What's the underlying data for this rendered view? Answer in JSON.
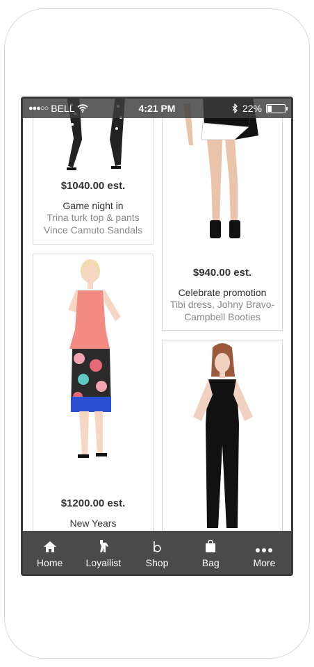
{
  "status_bar": {
    "carrier": "BELL",
    "time": "4:21 PM",
    "battery": "22%"
  },
  "cards": [
    {
      "price": "$1040.00 est.",
      "title": "Game night in",
      "lines": [
        "Trina turk top & pants",
        "Vince Camuto Sandals"
      ]
    },
    {
      "price": "$940.00 est.",
      "title": "Celebrate promotion",
      "lines": [
        "Tibi dress, Johny Bravo-",
        "Campbell Booties"
      ]
    },
    {
      "price": "$1200.00 est.",
      "title": "New Years",
      "lines": []
    },
    {
      "price": "",
      "title": "",
      "lines": []
    }
  ],
  "tab_bar": {
    "items": [
      {
        "label": "Home",
        "icon": "home-icon"
      },
      {
        "label": "Loyallist",
        "icon": "loyallist-icon"
      },
      {
        "label": "Shop",
        "icon": "shop-icon"
      },
      {
        "label": "Bag",
        "icon": "bag-icon"
      },
      {
        "label": "More",
        "icon": "more-icon"
      }
    ]
  }
}
